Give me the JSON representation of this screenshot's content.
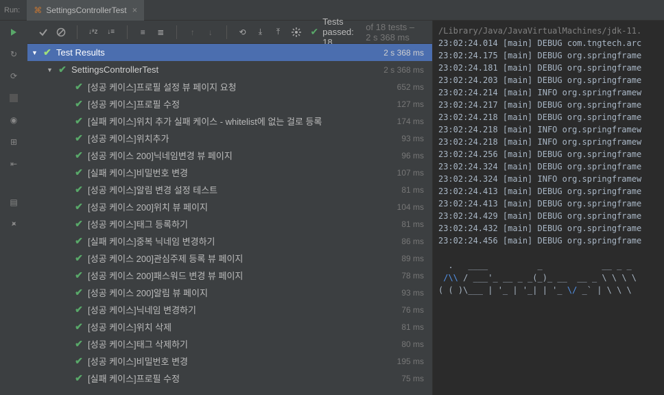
{
  "tabbar": {
    "runLabel": "Run:",
    "tabName": "SettingsControllerTest"
  },
  "status": {
    "passLabel": "Tests passed: 18",
    "dimLabel": "of 18 tests – 2 s 368 ms"
  },
  "tree": {
    "root": {
      "label": "Test Results",
      "time": "2 s 368 ms"
    },
    "suite": {
      "label": "SettingsControllerTest",
      "time": "2 s 368 ms"
    },
    "tests": [
      {
        "label": "[성공 케이스]프로필 설정 뷰 페이지 요청",
        "time": "652 ms"
      },
      {
        "label": "[성공 케이스]프로필 수정",
        "time": "127 ms"
      },
      {
        "label": "[실패 케이스]위치 추가 실패 케이스 - whitelist에 없는 걸로 등록",
        "time": "174 ms"
      },
      {
        "label": "[성공 케이스]위치추가",
        "time": "93 ms"
      },
      {
        "label": "[성공 케이스 200]닉네임변경 뷰 페이지",
        "time": "96 ms"
      },
      {
        "label": "[실패 케이스]비밀번호 변경",
        "time": "107 ms"
      },
      {
        "label": "[성공 케이스]알림 변경 설정 테스트",
        "time": "81 ms"
      },
      {
        "label": "[성공 케이스 200]위치 뷰 페이지",
        "time": "104 ms"
      },
      {
        "label": "[성공 케이스]태그 등록하기",
        "time": "81 ms"
      },
      {
        "label": "[실패 케이스]중복 닉네임 변경하기",
        "time": "86 ms"
      },
      {
        "label": "[성공 케이스 200]관심주제 등록 뷰 페이지",
        "time": "89 ms"
      },
      {
        "label": "[성공 케이스 200]패스워드 변경 뷰 페이지",
        "time": "78 ms"
      },
      {
        "label": "[성공 케이스 200]알림 뷰 페이지",
        "time": "93 ms"
      },
      {
        "label": "[성공 케이스]닉네임 변경하기",
        "time": "76 ms"
      },
      {
        "label": "[성공 케이스]위치 삭제",
        "time": "81 ms"
      },
      {
        "label": "[성공 케이스]태그 삭제하기",
        "time": "80 ms"
      },
      {
        "label": "[성공 케이스]비밀번호 변경",
        "time": "195 ms"
      },
      {
        "label": "[실패 케이스]프로필 수정",
        "time": "75 ms"
      }
    ]
  },
  "console": {
    "path": "/Library/Java/JavaVirtualMachines/jdk-11.",
    "lines": [
      "23:02:24.014 [main] DEBUG com.tngtech.arc",
      "23:02:24.175 [main] DEBUG org.springframe",
      "23:02:24.181 [main] DEBUG org.springframe",
      "23:02:24.203 [main] DEBUG org.springframe",
      "23:02:24.214 [main] INFO org.springframew",
      "23:02:24.217 [main] DEBUG org.springframe",
      "23:02:24.218 [main] DEBUG org.springframe",
      "23:02:24.218 [main] INFO org.springframew",
      "23:02:24.218 [main] INFO org.springframew",
      "23:02:24.256 [main] DEBUG org.springframe",
      "23:02:24.324 [main] DEBUG org.springframe",
      "23:02:24.324 [main] INFO org.springframew",
      "23:02:24.413 [main] DEBUG org.springframe",
      "23:02:24.413 [main] DEBUG org.springframe",
      "23:02:24.429 [main] DEBUG org.springframe",
      "23:02:24.432 [main] DEBUG org.springframe",
      "23:02:24.456 [main] DEBUG org.springframe"
    ],
    "ascii": [
      "  .   ____          _            __ _ _",
      " /\\\\ / ___'_ __ _ _(_)_ __  __ _ \\ \\ \\ \\",
      "( ( )\\___ | '_ | '_| | '_ \\/ _` | \\ \\ \\ "
    ]
  }
}
